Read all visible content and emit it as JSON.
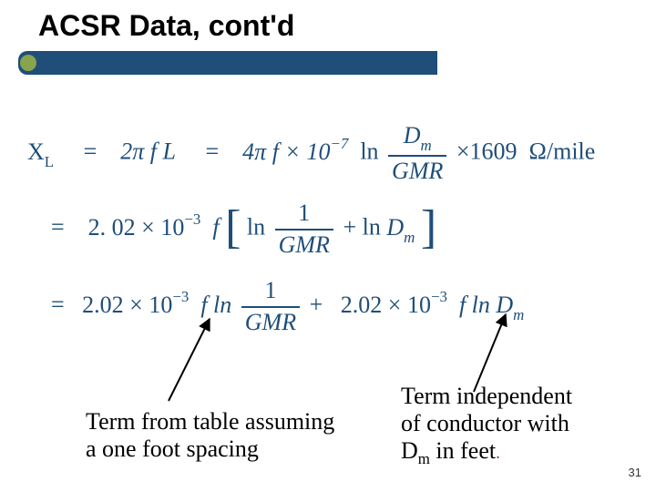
{
  "slide": {
    "title": "ACSR Data, cont'd",
    "page_number": "31"
  },
  "eq1": {
    "lhs_X": "X",
    "lhs_L": "L",
    "eq": "=",
    "twopi_f_L": "2π f L",
    "fourpi_f": "4π f × 10",
    "exp_neg7": "−7",
    "ln": "ln",
    "Dm": "D",
    "Dm_sub": "m",
    "GMR": "GMR",
    "times1609": "×1609",
    "ohms_per_mile": "Ω/mile"
  },
  "eq2": {
    "eq": "=",
    "coef": "2. 02 × 10",
    "exp_neg3": "−3",
    "f": "f",
    "ln": "ln",
    "one": "1",
    "GMR": "GMR",
    "plus_ln": "+ ln",
    "D": "D",
    "m": "m"
  },
  "eq3": {
    "eq": "=",
    "coef": "2.02 × 10",
    "exp_neg3": "−3",
    "f_ln": "f ln",
    "one": "1",
    "GMR": "GMR",
    "plus": "+",
    "coef2": "2.02 × 10",
    "exp_neg3b": "−3",
    "f_ln2": "f ln",
    "D": "D",
    "m": "m"
  },
  "annotLeft": {
    "line1": "Term from table assuming",
    "line2": "a one foot spacing"
  },
  "annotRight": {
    "line1": "Term independent",
    "line2": "of conductor with",
    "line3a": "D",
    "line3_sub": "m",
    "line3b": " in feet",
    "dot": "."
  }
}
